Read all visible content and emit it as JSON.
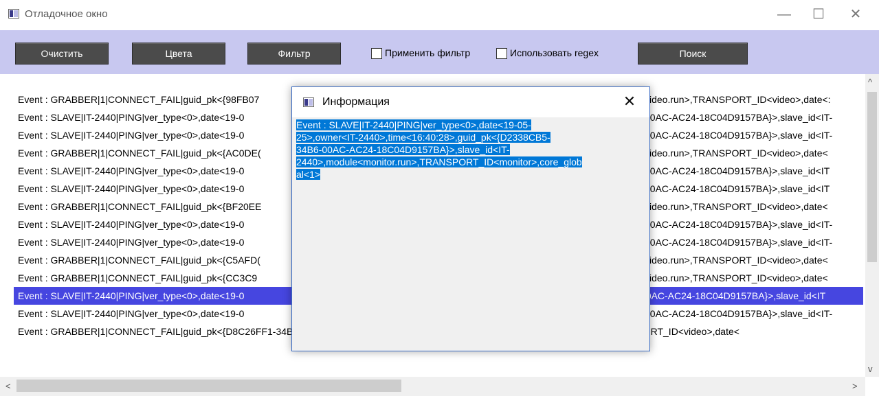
{
  "window": {
    "title": "Отладочное окно",
    "controls": [
      "—",
      "☐",
      "✕"
    ]
  },
  "toolbar": {
    "clear_label": "Очистить",
    "colors_label": "Цвета",
    "filter_label": "Фильтр",
    "apply_filter_label": "Применить фильтр",
    "use_regex_label": "Использовать regex",
    "search_label": "Поиск",
    "apply_filter_checked": false,
    "use_regex_checked": false
  },
  "log": {
    "lines": [
      {
        "left": "Event : GRABBER|1|CONNECT_FAIL|guid_pk<{98FB07",
        "right": "video.run>,TRANSPORT_ID<video>,date<:",
        "selected": false
      },
      {
        "left": "Event : SLAVE|IT-2440|PING|ver_type<0>,date<19-0",
        "right": "00AC-AC24-18C04D9157BA}>,slave_id<IT-",
        "selected": false
      },
      {
        "left": "Event : SLAVE|IT-2440|PING|ver_type<0>,date<19-0",
        "right": "00AC-AC24-18C04D9157BA}>,slave_id<IT-",
        "selected": false
      },
      {
        "left": "Event : GRABBER|1|CONNECT_FAIL|guid_pk<{AC0DE(",
        "right": "video.run>,TRANSPORT_ID<video>,date<",
        "selected": false
      },
      {
        "left": "Event : SLAVE|IT-2440|PING|ver_type<0>,date<19-0",
        "right": "00AC-AC24-18C04D9157BA}>,slave_id<IT",
        "selected": false
      },
      {
        "left": "Event : SLAVE|IT-2440|PING|ver_type<0>,date<19-0",
        "right": "00AC-AC24-18C04D9157BA}>,slave_id<IT",
        "selected": false
      },
      {
        "left": "Event : GRABBER|1|CONNECT_FAIL|guid_pk<{BF20EE",
        "right": "video.run>,TRANSPORT_ID<video>,date<",
        "selected": false
      },
      {
        "left": "Event : SLAVE|IT-2440|PING|ver_type<0>,date<19-0",
        "right": "00AC-AC24-18C04D9157BA}>,slave_id<IT-",
        "selected": false
      },
      {
        "left": "Event : SLAVE|IT-2440|PING|ver_type<0>,date<19-0",
        "right": "00AC-AC24-18C04D9157BA}>,slave_id<IT-",
        "selected": false
      },
      {
        "left": "Event : GRABBER|1|CONNECT_FAIL|guid_pk<{C5AFD(",
        "right": "video.run>,TRANSPORT_ID<video>,date<",
        "selected": false
      },
      {
        "left": "Event : GRABBER|1|CONNECT_FAIL|guid_pk<{CC3C9",
        "right": "video.run>,TRANSPORT_ID<video>,date<",
        "selected": false
      },
      {
        "left": "Event : SLAVE|IT-2440|PING|ver_type<0>,date<19-0",
        "right": "00AC-AC24-18C04D9157BA}>,slave_id<IT",
        "selected": true
      },
      {
        "left": "Event : SLAVE|IT-2440|PING|ver_type<0>,date<19-0",
        "right": "00AC-AC24-18C04D9157BA}>,slave_id<IT-",
        "selected": false
      },
      {
        "left": "Event : GRABBER|1|CONNECT_FAIL|guid_pk<{D8C26FF1-34B6-00AC-AC24-18C04D9157BA}>,slave_id<IT-2440>,module<video.run>,TRANSPORT_ID<video>,date<",
        "right": "",
        "selected": false
      }
    ]
  },
  "scroll": {
    "up_arrow": "^",
    "down_arrow": "v",
    "left_arrow": "<",
    "right_arrow": ">"
  },
  "dialog": {
    "title": "Информация",
    "close": "✕",
    "text_lines": [
      "Event : SLAVE|IT-2440|PING|ver_type<0>,date<19-05-",
      "25>,owner<IT-2440>,time<16:40:28>,guid_pk<{D2338CB5-",
      "34B6-00AC-AC24-18C04D9157BA}>,slave_id<IT-",
      "2440>,module<monitor.run>,TRANSPORT_ID<monitor>,core_glob",
      "al<1>"
    ]
  },
  "colors": {
    "toolbar_bg": "#c8c8f0",
    "selection": "#4646e0",
    "text_selection": "#0078d7"
  }
}
